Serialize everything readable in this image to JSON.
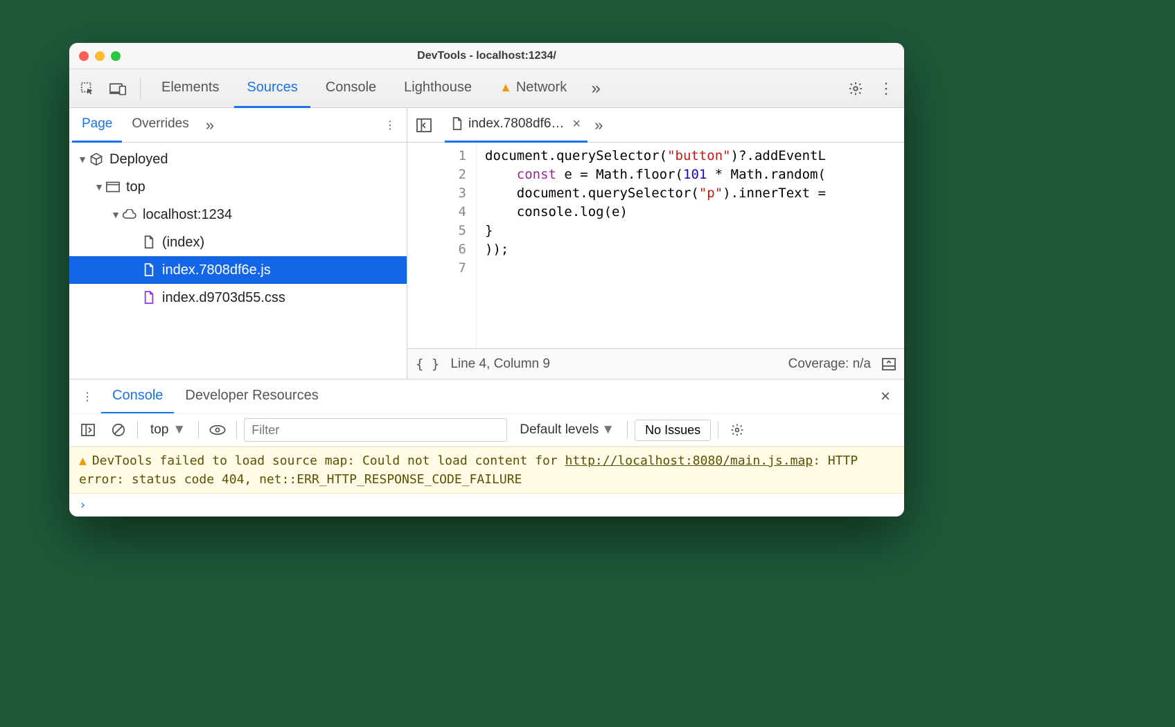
{
  "window": {
    "title": "DevTools - localhost:1234/"
  },
  "mainTabs": {
    "elements": "Elements",
    "sources": "Sources",
    "console": "Console",
    "lighthouse": "Lighthouse",
    "network": "Network"
  },
  "navigator": {
    "page": "Page",
    "overrides": "Overrides",
    "tree": {
      "deployed": "Deployed",
      "top": "top",
      "host": "localhost:1234",
      "index": "(index)",
      "jsfile": "index.7808df6e.js",
      "cssfile": "index.d9703d55.css"
    }
  },
  "editor": {
    "tabLabel": "index.7808df6…",
    "lines": [
      "1",
      "2",
      "3",
      "4",
      "5",
      "6",
      "7"
    ],
    "code": {
      "l1_a": "document.querySelector(",
      "l1_str": "\"button\"",
      "l1_b": ")?.addEventL",
      "l2_a": "    ",
      "l2_kw": "const",
      "l2_b": " e = Math.floor(",
      "l2_num": "101",
      "l2_c": " * Math.random(",
      "l3_a": "    document.querySelector(",
      "l3_str": "\"p\"",
      "l3_b": ").innerText =",
      "l4": "    console.log(e)",
      "l5": "}",
      "l6": "));",
      "l7": ""
    }
  },
  "status": {
    "format": "{ }",
    "pos": "Line 4, Column 9",
    "coverage": "Coverage: n/a"
  },
  "drawer": {
    "console": "Console",
    "devres": "Developer Resources"
  },
  "consoleToolbar": {
    "context": "top",
    "filterPlaceholder": "Filter",
    "levels": "Default levels",
    "issues": "No Issues"
  },
  "consoleMsg": {
    "pre": "DevTools failed to load source map: Could not load content for ",
    "url": "http://localhost:8080/main.js.map",
    "post": ": HTTP error: status code 404, net::ERR_HTTP_RESPONSE_CODE_FAILURE"
  }
}
